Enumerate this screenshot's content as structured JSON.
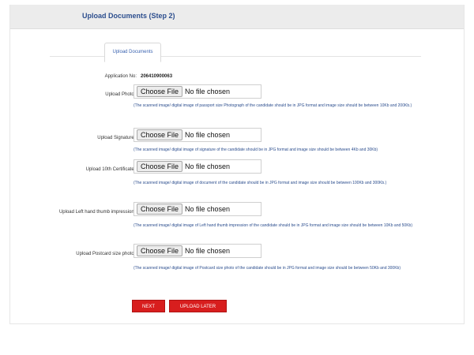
{
  "header": {
    "title": "Upload Documents (Step 2)"
  },
  "tab": {
    "label": "Upload Documents"
  },
  "application": {
    "label": "Application No:",
    "value": "206410900063"
  },
  "file_controls": {
    "choose_label": "Choose File",
    "no_file": "No file chosen"
  },
  "fields": [
    {
      "label": "Upload Photo :",
      "hint": "(The scanned image/ digital image of passport size Photograph of the candidate should be in JPG format and image size should be between 10Kb and 200Kb.)"
    },
    {
      "label": "Upload Signature :",
      "hint": "(The scanned image/ digital image of signature of the candidate should be in JPG format and image size should be between 4Kb and 30Kb)"
    },
    {
      "label": "Upload 10th Certificate :",
      "hint": "(The scanned image/ digital image of document of the candidate should be in JPG format and image size should be between 100Kb and 300Kb.)"
    },
    {
      "label": "Upload Left hand thumb impression :",
      "hint": "(The scanned image/ digital image of Left hand thumb impression of the candidate should be in JPG format and image size should be between 10Kb and 50Kb)"
    },
    {
      "label": "Upload Postcard size photo :",
      "hint": "(The scanned image/ digital image of Postcard size photo of the candidate should be in JPG format and image size should be between 50Kb and 300Kb)"
    }
  ],
  "buttons": {
    "next": "NEXT",
    "upload_later": "UPLOAD LATER"
  },
  "colors": {
    "accent": "#d81e1e",
    "link_text": "#2c4e8e",
    "header_bg": "#ececec"
  }
}
